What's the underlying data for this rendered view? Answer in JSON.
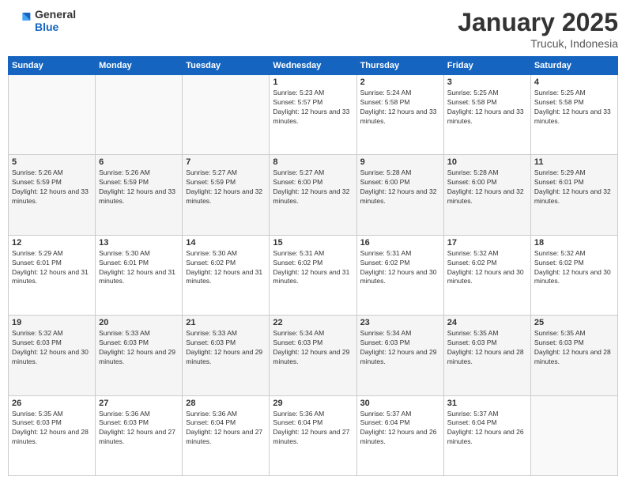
{
  "header": {
    "logo_general": "General",
    "logo_blue": "Blue",
    "month_title": "January 2025",
    "location": "Trucuk, Indonesia"
  },
  "weekdays": [
    "Sunday",
    "Monday",
    "Tuesday",
    "Wednesday",
    "Thursday",
    "Friday",
    "Saturday"
  ],
  "weeks": [
    [
      {
        "day": "",
        "sunrise": "",
        "sunset": "",
        "daylight": ""
      },
      {
        "day": "",
        "sunrise": "",
        "sunset": "",
        "daylight": ""
      },
      {
        "day": "",
        "sunrise": "",
        "sunset": "",
        "daylight": ""
      },
      {
        "day": "1",
        "sunrise": "Sunrise: 5:23 AM",
        "sunset": "Sunset: 5:57 PM",
        "daylight": "Daylight: 12 hours and 33 minutes."
      },
      {
        "day": "2",
        "sunrise": "Sunrise: 5:24 AM",
        "sunset": "Sunset: 5:58 PM",
        "daylight": "Daylight: 12 hours and 33 minutes."
      },
      {
        "day": "3",
        "sunrise": "Sunrise: 5:25 AM",
        "sunset": "Sunset: 5:58 PM",
        "daylight": "Daylight: 12 hours and 33 minutes."
      },
      {
        "day": "4",
        "sunrise": "Sunrise: 5:25 AM",
        "sunset": "Sunset: 5:58 PM",
        "daylight": "Daylight: 12 hours and 33 minutes."
      }
    ],
    [
      {
        "day": "5",
        "sunrise": "Sunrise: 5:26 AM",
        "sunset": "Sunset: 5:59 PM",
        "daylight": "Daylight: 12 hours and 33 minutes."
      },
      {
        "day": "6",
        "sunrise": "Sunrise: 5:26 AM",
        "sunset": "Sunset: 5:59 PM",
        "daylight": "Daylight: 12 hours and 33 minutes."
      },
      {
        "day": "7",
        "sunrise": "Sunrise: 5:27 AM",
        "sunset": "Sunset: 5:59 PM",
        "daylight": "Daylight: 12 hours and 32 minutes."
      },
      {
        "day": "8",
        "sunrise": "Sunrise: 5:27 AM",
        "sunset": "Sunset: 6:00 PM",
        "daylight": "Daylight: 12 hours and 32 minutes."
      },
      {
        "day": "9",
        "sunrise": "Sunrise: 5:28 AM",
        "sunset": "Sunset: 6:00 PM",
        "daylight": "Daylight: 12 hours and 32 minutes."
      },
      {
        "day": "10",
        "sunrise": "Sunrise: 5:28 AM",
        "sunset": "Sunset: 6:00 PM",
        "daylight": "Daylight: 12 hours and 32 minutes."
      },
      {
        "day": "11",
        "sunrise": "Sunrise: 5:29 AM",
        "sunset": "Sunset: 6:01 PM",
        "daylight": "Daylight: 12 hours and 32 minutes."
      }
    ],
    [
      {
        "day": "12",
        "sunrise": "Sunrise: 5:29 AM",
        "sunset": "Sunset: 6:01 PM",
        "daylight": "Daylight: 12 hours and 31 minutes."
      },
      {
        "day": "13",
        "sunrise": "Sunrise: 5:30 AM",
        "sunset": "Sunset: 6:01 PM",
        "daylight": "Daylight: 12 hours and 31 minutes."
      },
      {
        "day": "14",
        "sunrise": "Sunrise: 5:30 AM",
        "sunset": "Sunset: 6:02 PM",
        "daylight": "Daylight: 12 hours and 31 minutes."
      },
      {
        "day": "15",
        "sunrise": "Sunrise: 5:31 AM",
        "sunset": "Sunset: 6:02 PM",
        "daylight": "Daylight: 12 hours and 31 minutes."
      },
      {
        "day": "16",
        "sunrise": "Sunrise: 5:31 AM",
        "sunset": "Sunset: 6:02 PM",
        "daylight": "Daylight: 12 hours and 30 minutes."
      },
      {
        "day": "17",
        "sunrise": "Sunrise: 5:32 AM",
        "sunset": "Sunset: 6:02 PM",
        "daylight": "Daylight: 12 hours and 30 minutes."
      },
      {
        "day": "18",
        "sunrise": "Sunrise: 5:32 AM",
        "sunset": "Sunset: 6:02 PM",
        "daylight": "Daylight: 12 hours and 30 minutes."
      }
    ],
    [
      {
        "day": "19",
        "sunrise": "Sunrise: 5:32 AM",
        "sunset": "Sunset: 6:03 PM",
        "daylight": "Daylight: 12 hours and 30 minutes."
      },
      {
        "day": "20",
        "sunrise": "Sunrise: 5:33 AM",
        "sunset": "Sunset: 6:03 PM",
        "daylight": "Daylight: 12 hours and 29 minutes."
      },
      {
        "day": "21",
        "sunrise": "Sunrise: 5:33 AM",
        "sunset": "Sunset: 6:03 PM",
        "daylight": "Daylight: 12 hours and 29 minutes."
      },
      {
        "day": "22",
        "sunrise": "Sunrise: 5:34 AM",
        "sunset": "Sunset: 6:03 PM",
        "daylight": "Daylight: 12 hours and 29 minutes."
      },
      {
        "day": "23",
        "sunrise": "Sunrise: 5:34 AM",
        "sunset": "Sunset: 6:03 PM",
        "daylight": "Daylight: 12 hours and 29 minutes."
      },
      {
        "day": "24",
        "sunrise": "Sunrise: 5:35 AM",
        "sunset": "Sunset: 6:03 PM",
        "daylight": "Daylight: 12 hours and 28 minutes."
      },
      {
        "day": "25",
        "sunrise": "Sunrise: 5:35 AM",
        "sunset": "Sunset: 6:03 PM",
        "daylight": "Daylight: 12 hours and 28 minutes."
      }
    ],
    [
      {
        "day": "26",
        "sunrise": "Sunrise: 5:35 AM",
        "sunset": "Sunset: 6:03 PM",
        "daylight": "Daylight: 12 hours and 28 minutes."
      },
      {
        "day": "27",
        "sunrise": "Sunrise: 5:36 AM",
        "sunset": "Sunset: 6:03 PM",
        "daylight": "Daylight: 12 hours and 27 minutes."
      },
      {
        "day": "28",
        "sunrise": "Sunrise: 5:36 AM",
        "sunset": "Sunset: 6:04 PM",
        "daylight": "Daylight: 12 hours and 27 minutes."
      },
      {
        "day": "29",
        "sunrise": "Sunrise: 5:36 AM",
        "sunset": "Sunset: 6:04 PM",
        "daylight": "Daylight: 12 hours and 27 minutes."
      },
      {
        "day": "30",
        "sunrise": "Sunrise: 5:37 AM",
        "sunset": "Sunset: 6:04 PM",
        "daylight": "Daylight: 12 hours and 26 minutes."
      },
      {
        "day": "31",
        "sunrise": "Sunrise: 5:37 AM",
        "sunset": "Sunset: 6:04 PM",
        "daylight": "Daylight: 12 hours and 26 minutes."
      },
      {
        "day": "",
        "sunrise": "",
        "sunset": "",
        "daylight": ""
      }
    ]
  ]
}
